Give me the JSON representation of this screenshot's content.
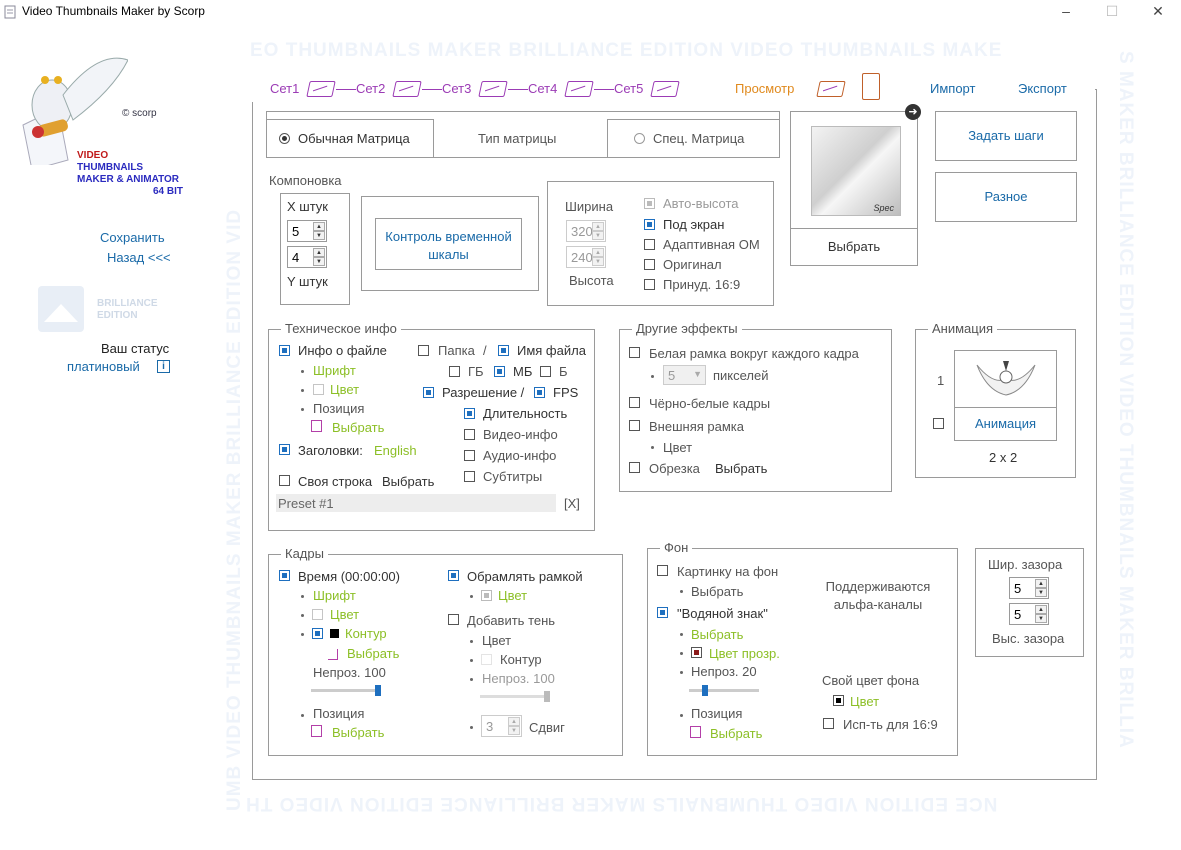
{
  "window": {
    "title": "Video Thumbnails Maker by Scorp"
  },
  "colors": {
    "accent": "#1a6aa8",
    "green": "#8cbf26",
    "purple": "#9b3bb5",
    "orange": "#e08a1e"
  },
  "watermark": {
    "top": "EO THUMBNAILS MAKER  BRILLIANCE EDITION  VIDEO THUMBNAILS MAKE",
    "bottom": "NCE EDITION  VIDEO THUMBNAILS MAKER  BRILLIANCE EDITION  VIDEO TH",
    "left": "UMB  VIDEO THUMBNAILS MAKER  BRILLIANCE EDITION  VID",
    "right": "S MAKER  BRILLIANCE EDITION  VIDEO THUMBNAILS MAKER  BRILLIA"
  },
  "sidebar": {
    "copyright": "© scorp",
    "logo_lines": [
      "VIDEO",
      "THUMBNAILS",
      "MAKER & ANIMATOR",
      "64 BIT"
    ],
    "save": "Сохранить",
    "back": "Назад <<<",
    "edition": [
      "BRILLIANCE",
      "EDITION"
    ],
    "status_label": "Ваш статус",
    "status_value": "платиновый",
    "status_icon": "i"
  },
  "tabs": [
    "Сет1",
    "Сет2",
    "Сет3",
    "Сет4",
    "Сет5",
    "Просмотр",
    "Импорт",
    "Экспорт"
  ],
  "matrix": {
    "normal": "Обычная Матрица",
    "type": "Тип матрицы",
    "special": "Спец. Матрица"
  },
  "preview": {
    "choose": "Выбрать",
    "signature": "Spec"
  },
  "buttons": {
    "steps": "Задать шаги",
    "misc": "Разное"
  },
  "layout": {
    "title": "Компоновка",
    "x_label": "X штук",
    "x_value": "5",
    "y_value": "4",
    "y_label": "Y штук",
    "timeline": "Контроль временной шкалы",
    "width_label": "Ширина",
    "width_value": "320",
    "height_value": "240",
    "height_label": "Высота",
    "options": [
      "Авто-высота",
      "Под экран",
      "Адаптивная ОМ",
      "Оригинал",
      "Принуд. 16:9"
    ]
  },
  "tech": {
    "title": "Техническое  инфо",
    "file_info": "Инфо о файле",
    "font": "Шрифт",
    "color": "Цвет",
    "position": "Позиция",
    "choose": "Выбрать",
    "headers": "Заголовки:",
    "headers_lang": "English",
    "custom_line": "Своя строка",
    "custom_choose": "Выбрать",
    "folder": "Папка",
    "slash": "/",
    "filename": "Имя файла",
    "gb": "ГБ",
    "mb": "МБ",
    "b": "Б",
    "resolution": "Разрешение /",
    "fps": "FPS",
    "duration": "Длительность",
    "video": "Видео-инфо",
    "audio": "Аудио-инфо",
    "subs": "Субтитры",
    "preset": "Preset #1",
    "preset_close": "[X]"
  },
  "effects": {
    "title": "Другие эффекты",
    "white_frame": "Белая рамка вокруг каждого кадра",
    "px_value": "5",
    "px_label": "пикселей",
    "bw": "Чёрно-белые кадры",
    "outer": "Внешняя рамка",
    "color": "Цвет",
    "crop": "Обрезка",
    "choose": "Выбрать"
  },
  "animation": {
    "title": "Анимация",
    "number": "1",
    "button": "Анимация",
    "grid": "2  x  2"
  },
  "frames": {
    "title": "Кадры",
    "time": "Время (00:00:00)",
    "font": "Шрифт",
    "color": "Цвет",
    "outline": "Контур",
    "choose": "Выбрать",
    "opacity": "Непроз. 100",
    "opacity_value": 100,
    "position": "Позиция",
    "border": "Обрамлять рамкой",
    "border_color": "Цвет",
    "shadow": "Добавить тень",
    "shadow_color": "Цвет",
    "shadow_outline": "Контур",
    "shadow_opacity": "Непроз. 100",
    "shadow_opacity_value": 100,
    "shift_value": "3",
    "shift": "Сдвиг"
  },
  "background": {
    "title": "Фон",
    "picture": "Картинку на фон",
    "choose": "Выбрать",
    "alpha": "Поддерживаются альфа-каналы",
    "watermark": "\"Водяной знак\"",
    "wm_choose": "Выбрать",
    "transp": "Цвет прозр.",
    "opacity": "Непроз. 20",
    "opacity_value": 20,
    "position": "Позиция",
    "pos_choose": "Выбрать",
    "own_color": "Свой цвет фона",
    "color": "Цвет",
    "use169": "Исп-ть для 16:9"
  },
  "gap": {
    "width_label": "Шир. зазора",
    "w": "5",
    "h": "5",
    "height_label": "Выс. зазора"
  }
}
